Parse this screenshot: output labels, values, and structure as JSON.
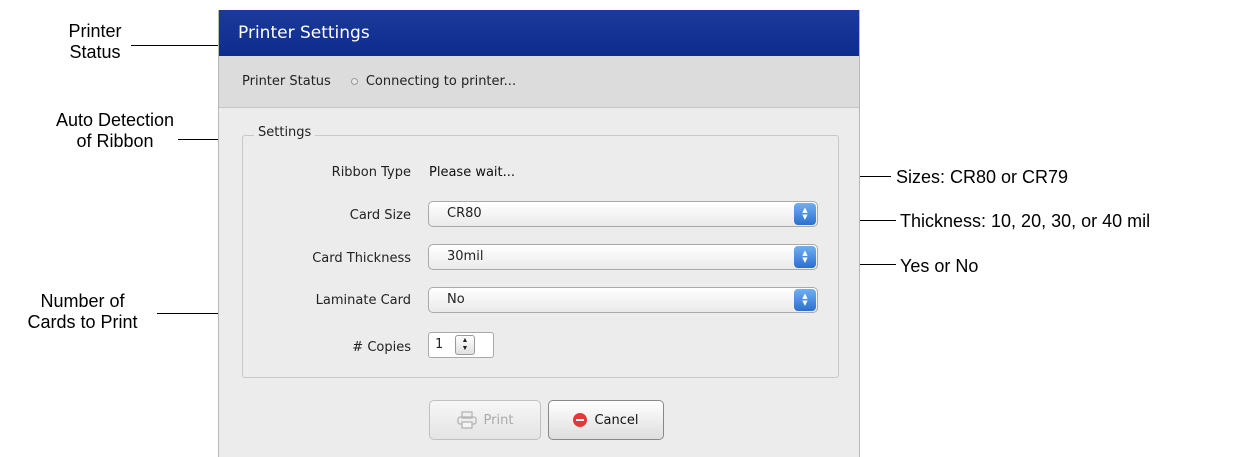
{
  "callouts": {
    "printer_status": [
      "Printer",
      "Status"
    ],
    "auto_detection": [
      "Auto Detection",
      "of Ribbon"
    ],
    "number_of_cards": [
      "Number of",
      "Cards to Print"
    ],
    "sizes": "Sizes: CR80 or CR79",
    "thickness": "Thickness: 10, 20, 30, or 40 mil",
    "yes_no": "Yes or No"
  },
  "dialog": {
    "title": "Printer Settings",
    "status_label": "Printer Status",
    "status_text": "Connecting to printer...",
    "settings_legend": "Settings",
    "ribbon_type": {
      "label": "Ribbon Type",
      "value": "Please wait..."
    },
    "card_size": {
      "label": "Card Size",
      "value": "CR80"
    },
    "card_thickness": {
      "label": "Card Thickness",
      "value": "30mil"
    },
    "laminate_card": {
      "label": "Laminate Card",
      "value": "No"
    },
    "copies": {
      "label": "# Copies",
      "value": "1"
    },
    "print_button": "Print",
    "cancel_button": "Cancel"
  },
  "colors": {
    "title_bar": "#0d2c8e",
    "select_arrow": "#2b6fcf",
    "cancel_icon": "#e2373b"
  }
}
